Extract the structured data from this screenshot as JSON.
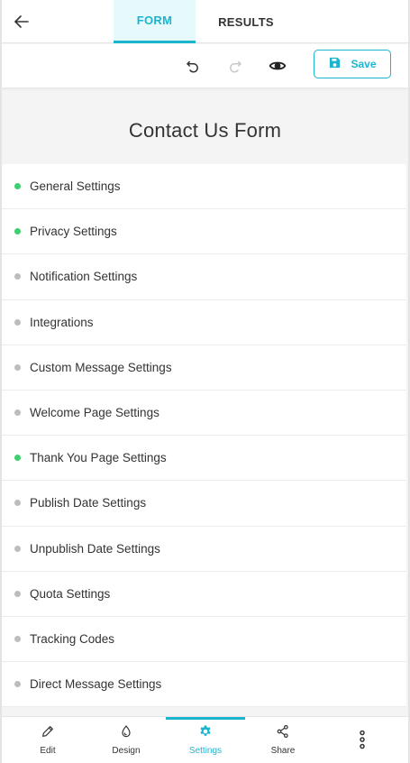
{
  "header": {
    "tabs": [
      {
        "label": "FORM",
        "active": true
      },
      {
        "label": "RESULTS",
        "active": false
      }
    ]
  },
  "toolbar": {
    "save_label": "Save"
  },
  "form_title": "Contact Us Form",
  "settings": {
    "items": [
      {
        "label": "General Settings",
        "status": "active"
      },
      {
        "label": "Privacy Settings",
        "status": "active"
      },
      {
        "label": "Notification Settings",
        "status": "inactive"
      },
      {
        "label": "Integrations",
        "status": "inactive"
      },
      {
        "label": "Custom Message Settings",
        "status": "inactive"
      },
      {
        "label": "Welcome Page Settings",
        "status": "inactive"
      },
      {
        "label": "Thank You Page Settings",
        "status": "active"
      },
      {
        "label": "Publish Date Settings",
        "status": "inactive"
      },
      {
        "label": "Unpublish Date Settings",
        "status": "inactive"
      },
      {
        "label": "Quota Settings",
        "status": "inactive"
      },
      {
        "label": "Tracking Codes",
        "status": "inactive"
      },
      {
        "label": "Direct Message Settings",
        "status": "inactive"
      }
    ]
  },
  "bottom_nav": {
    "items": [
      {
        "label": "Edit",
        "icon": "pencil-icon"
      },
      {
        "label": "Design",
        "icon": "droplet-icon"
      },
      {
        "label": "Settings",
        "icon": "gear-icon",
        "active": true
      },
      {
        "label": "Share",
        "icon": "share-icon"
      },
      {
        "label": "",
        "icon": "more-vertical-icon"
      }
    ]
  },
  "colors": {
    "accent": "#1cb5cf",
    "status_active": "#3ecf6e",
    "status_inactive": "#bdbdbd",
    "tab_active_bg": "#e6f9fb"
  }
}
